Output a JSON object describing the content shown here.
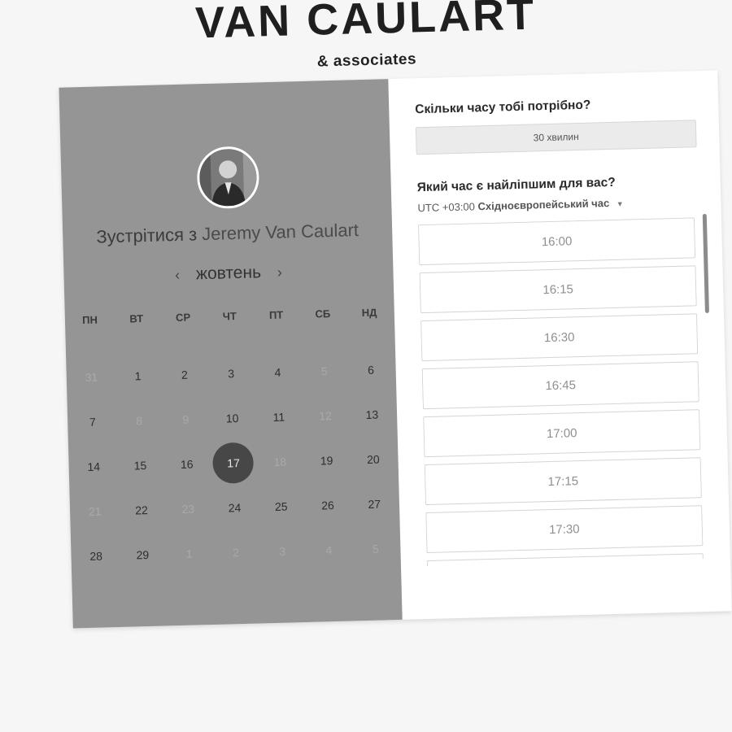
{
  "brand": {
    "title": "VAN CAULART",
    "subtitle": "& associates"
  },
  "host": {
    "prefix": "Зустрітися з",
    "name": "Jeremy Van Caulart",
    "avatar_icon": "person-photo"
  },
  "calendar": {
    "month": "жовтень",
    "prev_icon": "‹",
    "next_icon": "›",
    "weekdays": [
      "ПН",
      "ВТ",
      "СР",
      "ЧТ",
      "ПТ",
      "СБ",
      "НД"
    ],
    "days": [
      {
        "label": "31",
        "muted": true
      },
      {
        "label": "1",
        "muted": false
      },
      {
        "label": "2",
        "muted": false
      },
      {
        "label": "3",
        "muted": false
      },
      {
        "label": "4",
        "muted": false
      },
      {
        "label": "5",
        "muted": true
      },
      {
        "label": "6",
        "muted": false
      },
      {
        "label": "7",
        "muted": false
      },
      {
        "label": "8",
        "muted": true
      },
      {
        "label": "9",
        "muted": true
      },
      {
        "label": "10",
        "muted": false
      },
      {
        "label": "11",
        "muted": false
      },
      {
        "label": "12",
        "muted": true
      },
      {
        "label": "13",
        "muted": false
      },
      {
        "label": "14",
        "muted": false
      },
      {
        "label": "15",
        "muted": false
      },
      {
        "label": "16",
        "muted": false
      },
      {
        "label": "17",
        "muted": false,
        "selected": true
      },
      {
        "label": "18",
        "muted": true
      },
      {
        "label": "19",
        "muted": false
      },
      {
        "label": "20",
        "muted": false
      },
      {
        "label": "21",
        "muted": true
      },
      {
        "label": "22",
        "muted": false
      },
      {
        "label": "23",
        "muted": true
      },
      {
        "label": "24",
        "muted": false
      },
      {
        "label": "25",
        "muted": false
      },
      {
        "label": "26",
        "muted": false
      },
      {
        "label": "27",
        "muted": false
      },
      {
        "label": "28",
        "muted": false
      },
      {
        "label": "29",
        "muted": false
      },
      {
        "label": "1",
        "muted": true
      },
      {
        "label": "2",
        "muted": true
      },
      {
        "label": "3",
        "muted": true
      },
      {
        "label": "4",
        "muted": true
      },
      {
        "label": "5",
        "muted": true
      }
    ]
  },
  "booking": {
    "duration_question": "Скільки часу тобі потрібно?",
    "duration_value": "30 хвилин",
    "time_question": "Який час є найліпшим для вас?",
    "timezone_offset": "UTC +03:00",
    "timezone_name": "Східноєвропейський час",
    "slots": [
      "16:00",
      "16:15",
      "16:30",
      "16:45",
      "17:00",
      "17:15",
      "17:30",
      ""
    ]
  },
  "colors": {
    "left_panel": "#959595",
    "selected_day": "#474747",
    "page_bg": "#f6f6f6"
  }
}
